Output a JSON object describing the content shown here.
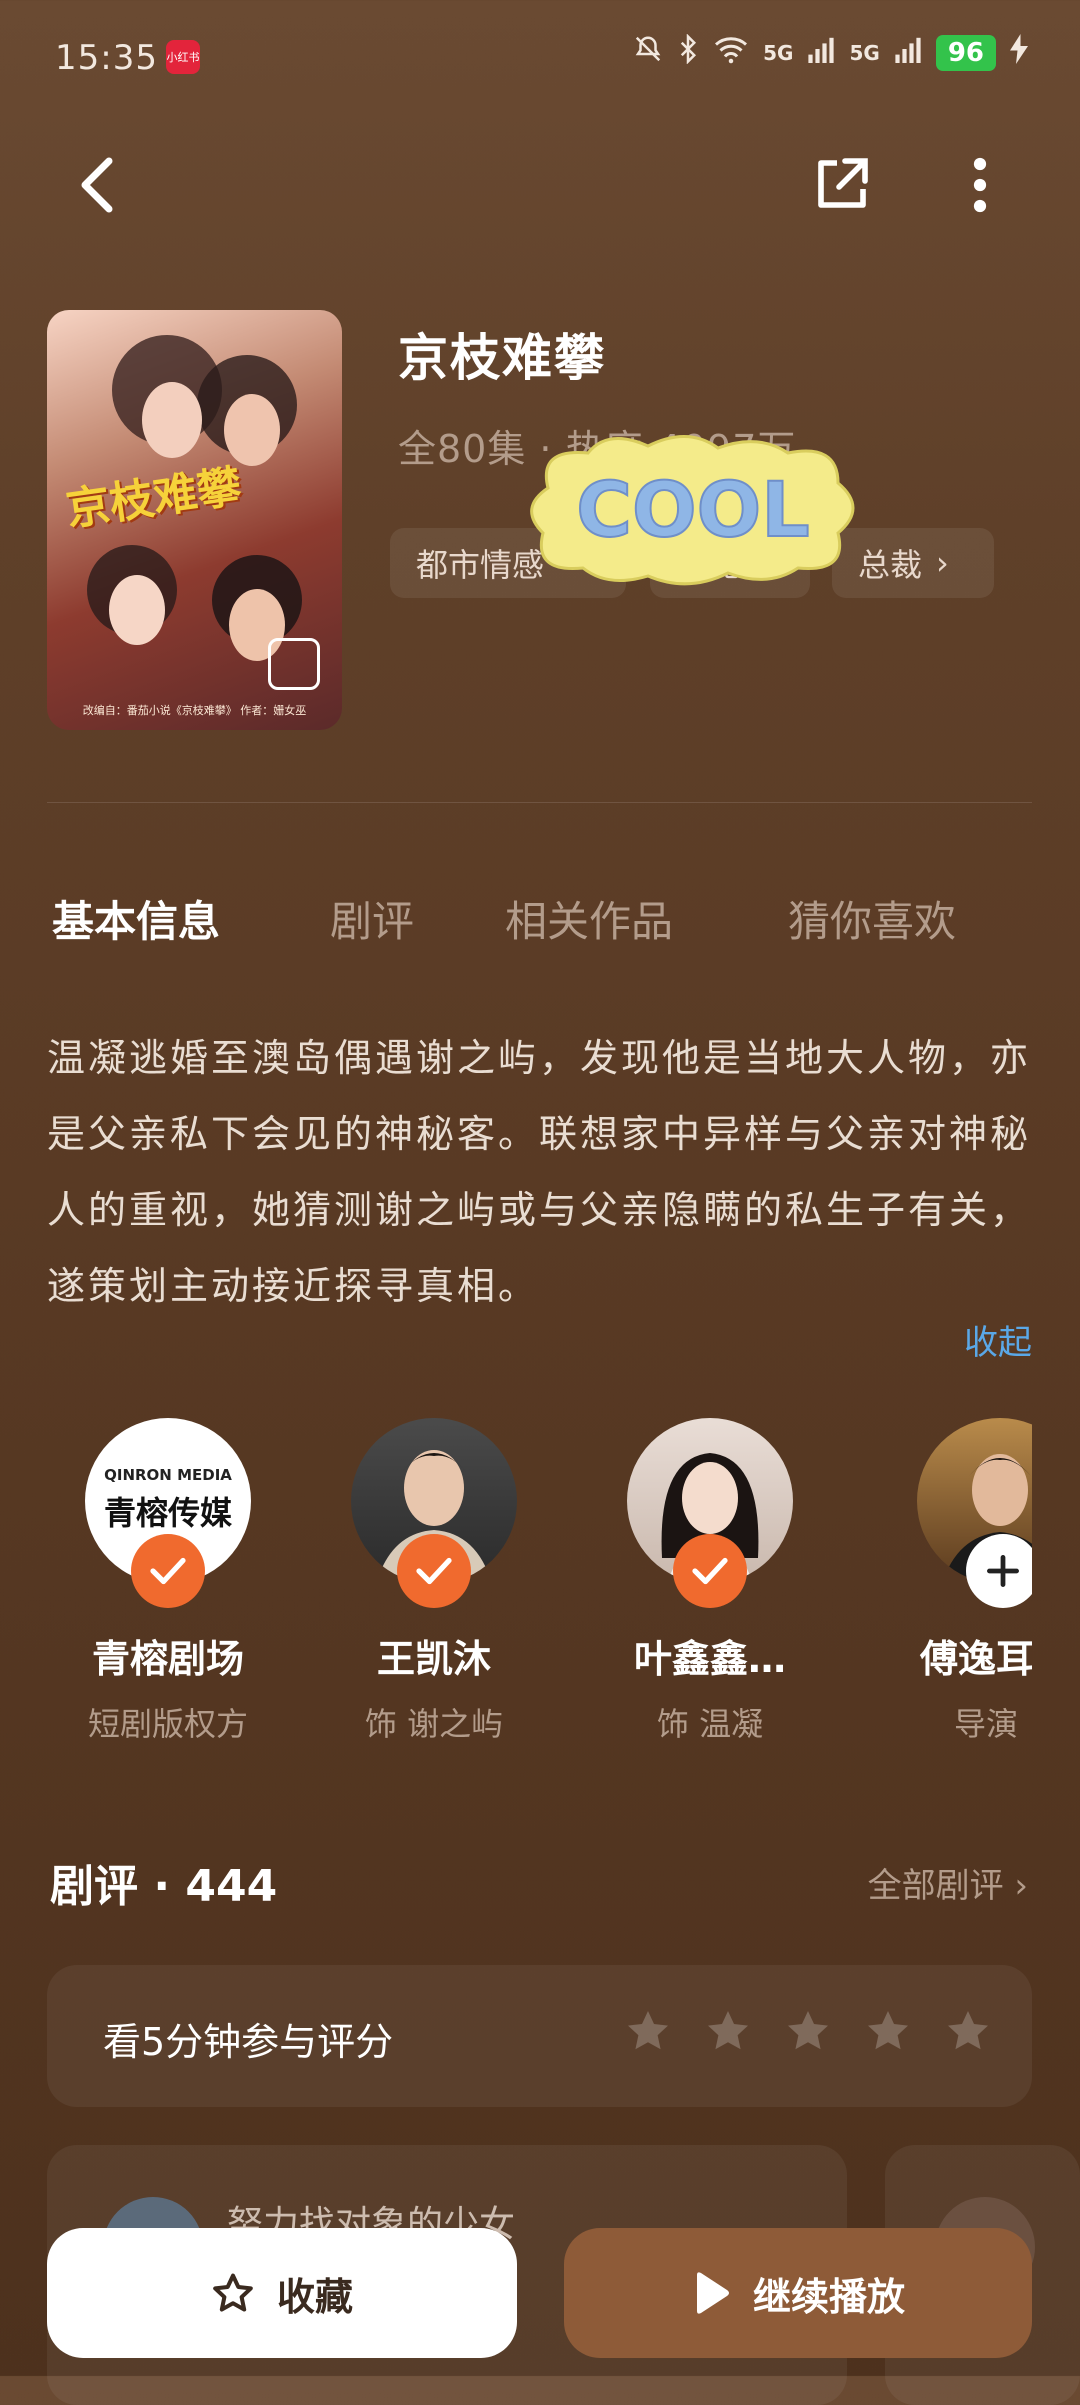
{
  "status": {
    "time": "15:35",
    "app_badge": "小红书",
    "battery": "96",
    "net1": "5G",
    "net2": "5G"
  },
  "drama": {
    "title": "京枝难攀",
    "meta": "全80集 · 热度 4097万",
    "poster_title": "京枝难攀",
    "poster_caption": "改编自：番茄小说《京枝难攀》 作者：姗女巫",
    "tags": [
      "都市情感",
      "甜宠",
      "总裁"
    ]
  },
  "sticker": {
    "text": "COOL"
  },
  "tabs": [
    "基本信息",
    "剧评",
    "相关作品",
    "猜你喜欢"
  ],
  "description": "温凝逃婚至澳岛偶遇谢之屿，发现他是当地大人物，亦是父亲私下会见的神秘客。联想家中异样与父亲对神秘人的重视，她猜测谢之屿或与父亲隐瞒的私生子有关，遂策划主动接近探寻真相。",
  "collapse_label": "收起",
  "people": [
    {
      "name": "青榕剧场",
      "role": "短剧版权方",
      "logo_line1": "QINRON MEDIA",
      "logo_line2": "青榕传媒"
    },
    {
      "name": "王凯沐",
      "role": "饰 谢之屿"
    },
    {
      "name": "叶鑫鑫…",
      "role": "饰 温凝"
    },
    {
      "name": "傅逸耳",
      "role": "导演"
    }
  ],
  "reviews": {
    "title": "剧评 · 444",
    "all_label": "全部剧评 ›",
    "rate_prompt": "看5分钟参与评分",
    "star_count": 5,
    "preview_text": "努力找对象的少女"
  },
  "actions": {
    "favorite": "收藏",
    "play": "继续播放"
  },
  "colors": {
    "accent": "#f06a2e",
    "link": "#5aa8e8",
    "play_button": "#8e5b38"
  }
}
